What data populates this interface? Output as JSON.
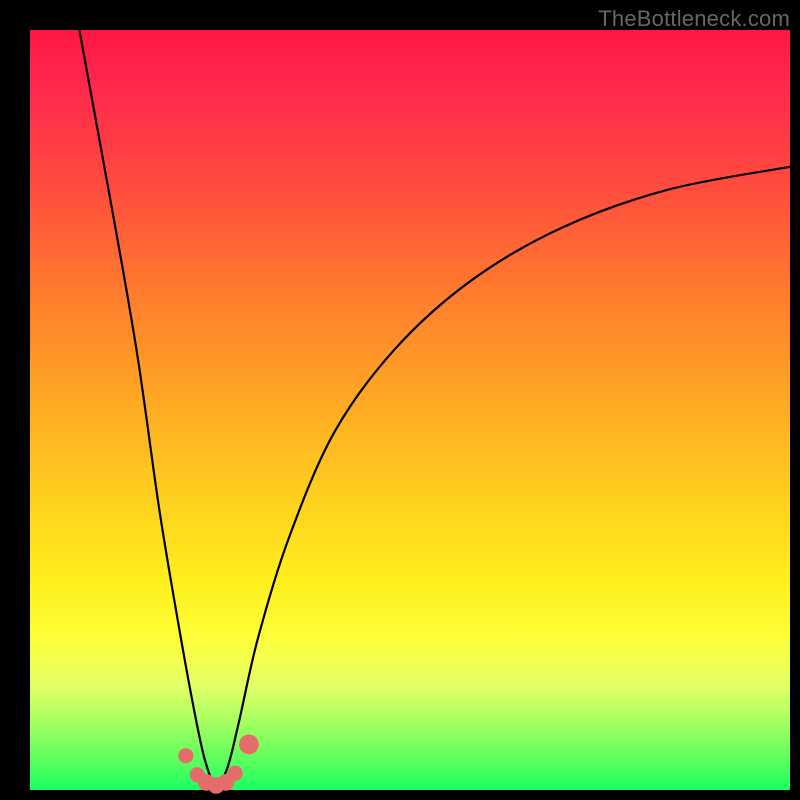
{
  "attribution": "TheBottleneck.com",
  "colors": {
    "background": "#000000",
    "gradient_top": "#ff1744",
    "gradient_mid": "#ffd11f",
    "gradient_bottom": "#1aff63",
    "curve": "#000000",
    "markers": "#e66b6b",
    "attribution_text": "#676767"
  },
  "chart_data": {
    "type": "line",
    "title": "",
    "xlabel": "",
    "ylabel": "",
    "xlim": [
      0,
      100
    ],
    "ylim": [
      0,
      100
    ],
    "grid": false,
    "legend": false,
    "note": "Values are percentages of the visible plot area (0,0 at bottom-left, 100,100 at top-right). Curve is a sharp V whose minimum reaches ~0 near x≈24.5; left branch starts at top edge near x≈6.5, right branch exits right edge near y≈82.",
    "series": [
      {
        "name": "bottleneck-curve",
        "x": [
          6.5,
          10,
          14,
          17,
          19.5,
          21.5,
          23,
          24.5,
          26,
          27.5,
          30,
          34,
          40,
          48,
          58,
          70,
          84,
          100
        ],
        "values": [
          100,
          81,
          58,
          37,
          22,
          11,
          4,
          0.5,
          3,
          9,
          20,
          33,
          47,
          58,
          67,
          74,
          79,
          82
        ]
      }
    ],
    "markers": {
      "name": "valley-markers",
      "points": [
        {
          "x": 20.5,
          "y": 4.5,
          "r": 1.0
        },
        {
          "x": 22.0,
          "y": 2.0,
          "r": 1.0
        },
        {
          "x": 23.2,
          "y": 1.0,
          "r": 1.1
        },
        {
          "x": 24.5,
          "y": 0.6,
          "r": 1.1
        },
        {
          "x": 25.8,
          "y": 1.0,
          "r": 1.1
        },
        {
          "x": 27.0,
          "y": 2.2,
          "r": 1.0
        },
        {
          "x": 28.8,
          "y": 6.0,
          "r": 1.3
        }
      ]
    }
  }
}
